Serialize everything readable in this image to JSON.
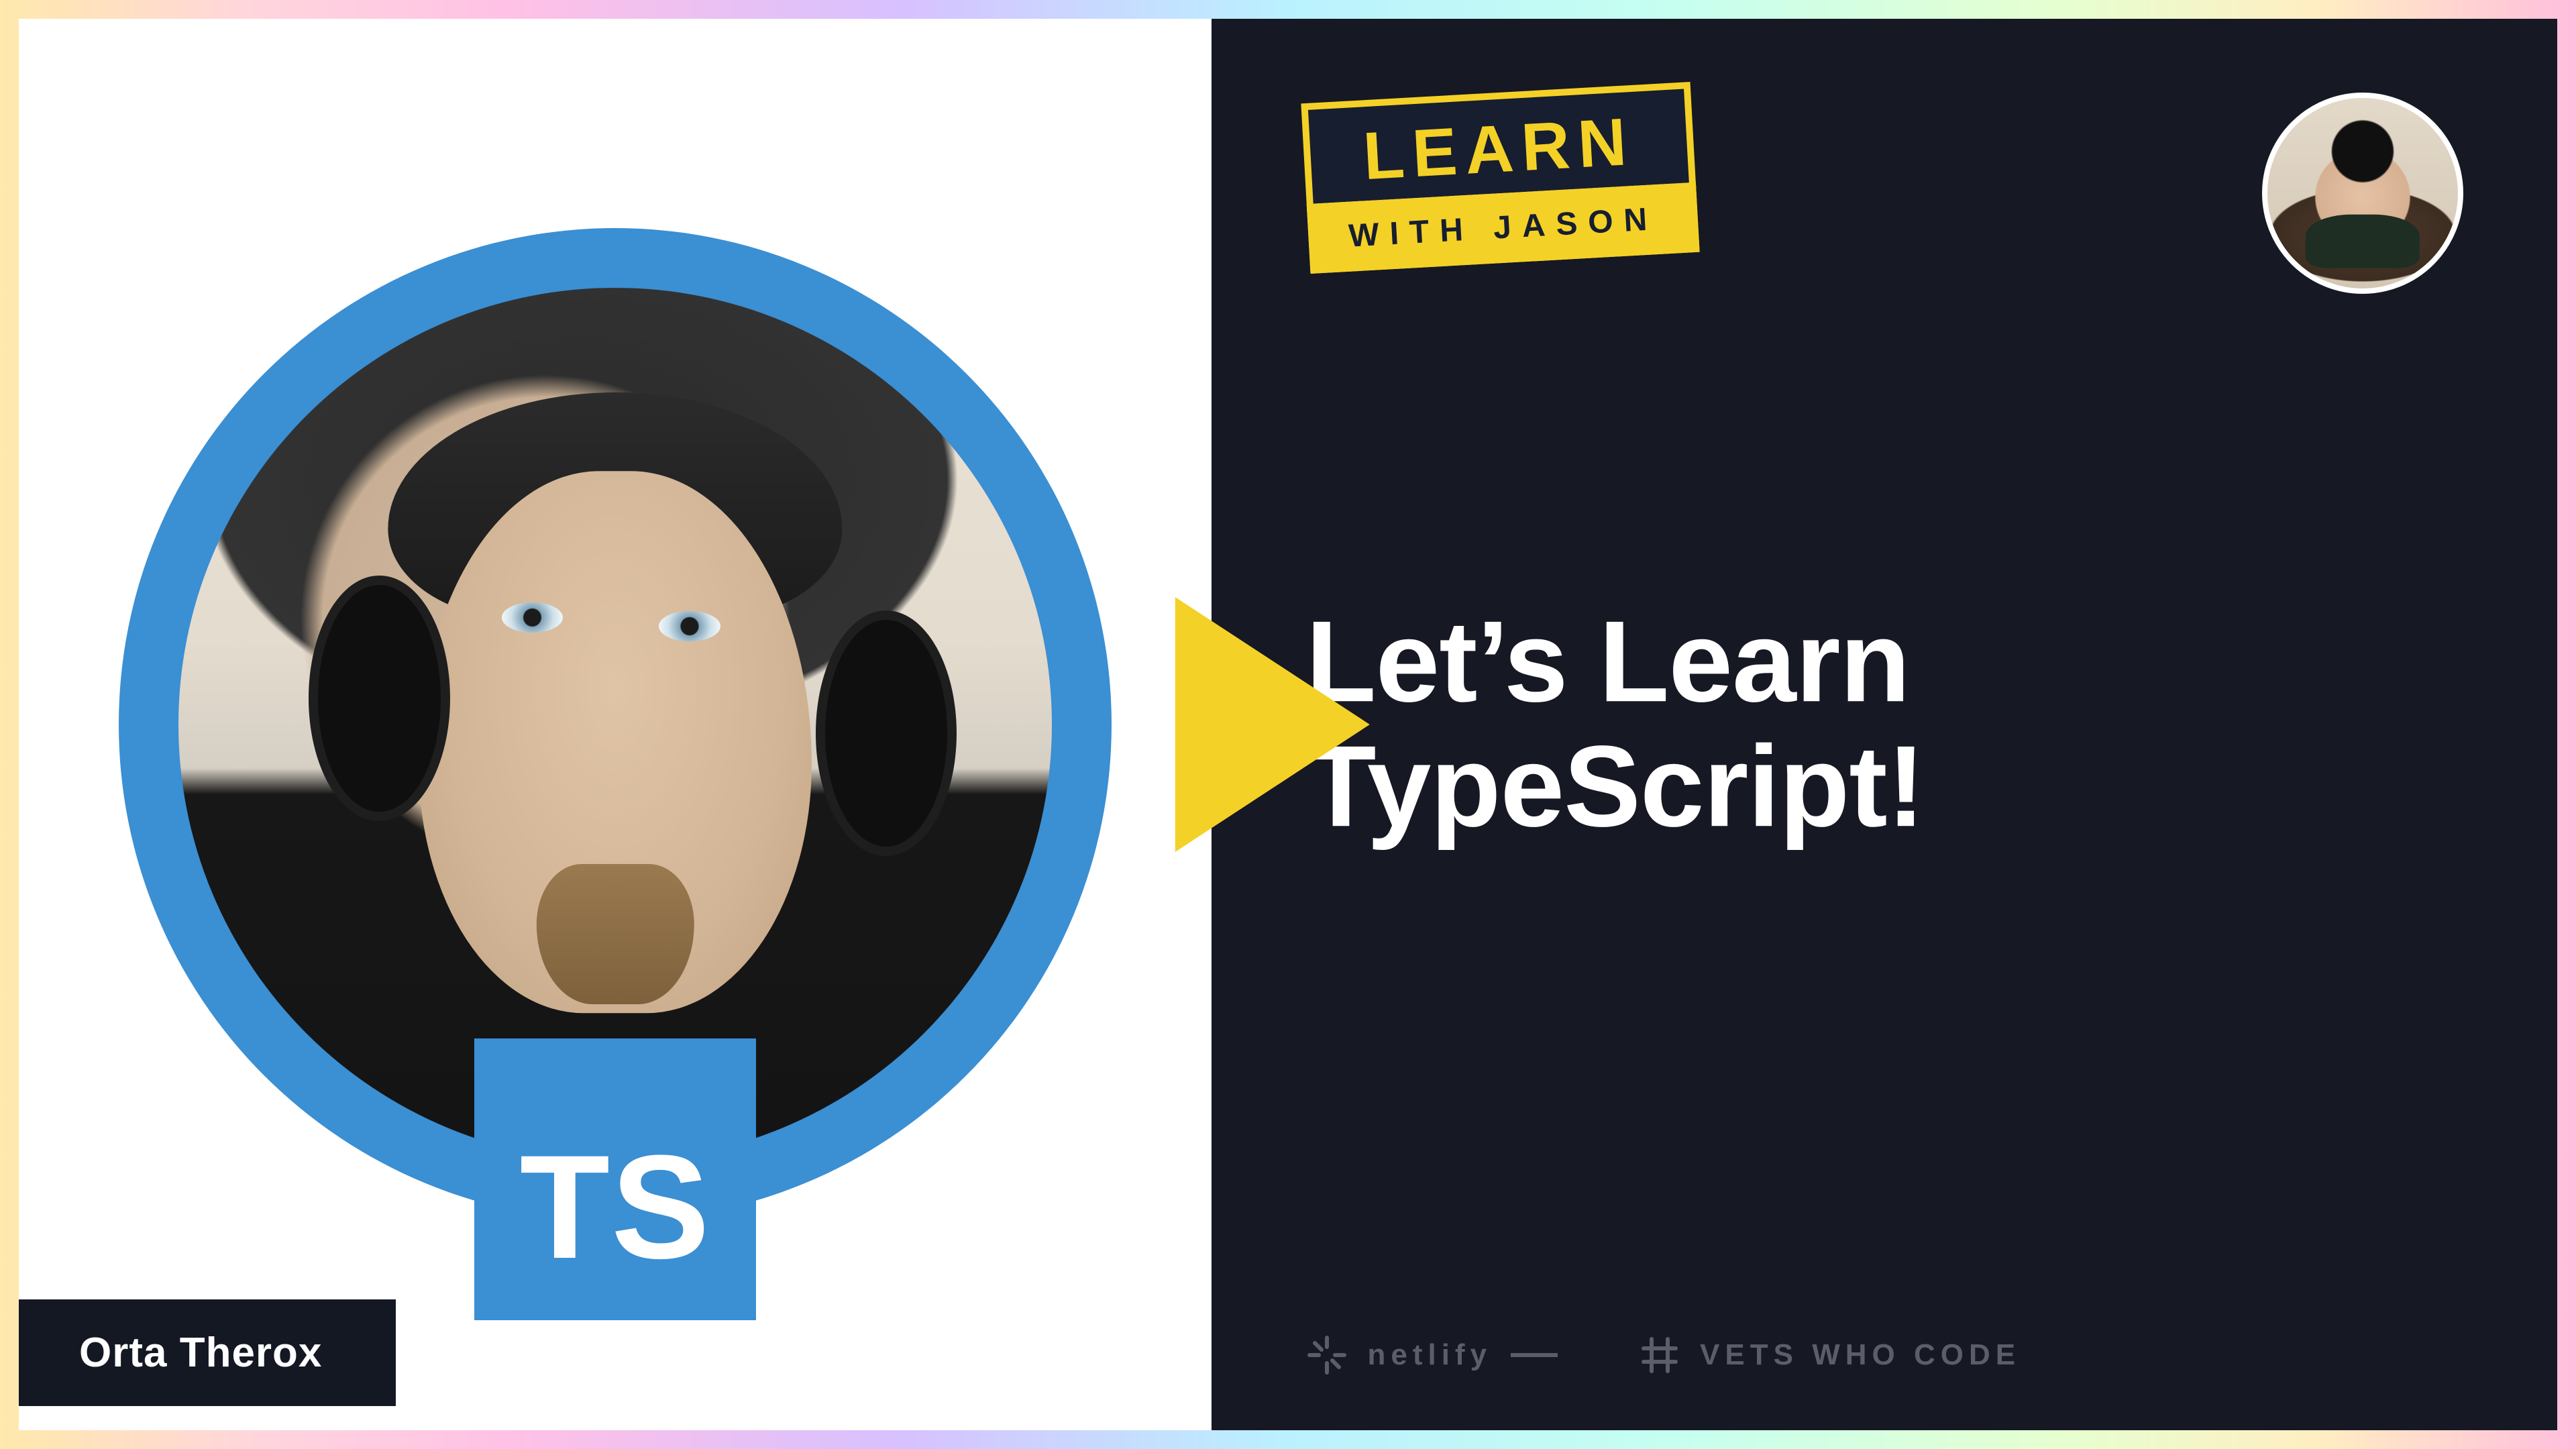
{
  "left": {
    "guest_name": "Orta Therox",
    "badge_text": "TS"
  },
  "right": {
    "logo_top": "LEARN",
    "logo_bottom": "WITH JASON",
    "episode_title": "Let’s Learn TypeScript!"
  },
  "sponsors": {
    "netlify": "netlify",
    "vwc": "VETS WHO CODE"
  },
  "colors": {
    "brand_yellow": "#f4d127",
    "brand_navy": "#171e30",
    "bg_dark": "#161823",
    "ts_blue": "#3b8fd3"
  },
  "icons": {
    "play": "play-icon",
    "netlify_spark": "spark-icon",
    "vwc_hash": "hash-flag-icon"
  }
}
